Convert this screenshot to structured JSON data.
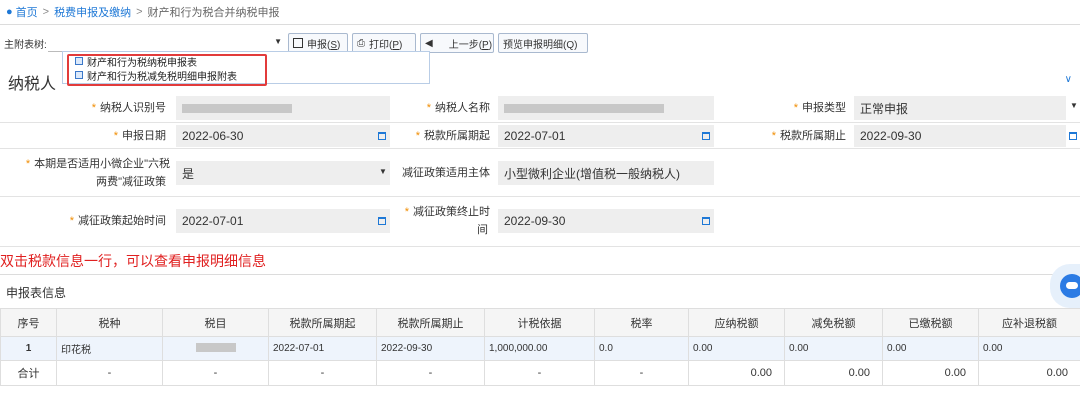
{
  "breadcrumb": {
    "home": "首页",
    "section": "税费申报及缴纳",
    "current": "财产和行为税合并纳税申报"
  },
  "toolbar": {
    "main_sub_label": "主附表树:",
    "declare_label": "申报(",
    "declare_key": "S",
    "print_label": "打印(",
    "print_key": "P",
    "prev_label": "上一步(",
    "prev_key": "P",
    "preview_label": "预览申报明细(Q)"
  },
  "dropdown": {
    "items": [
      "财产和行为税纳税申报表",
      "财产和行为税减免税明细申报附表"
    ]
  },
  "panel": {
    "title_visible": "纳税人"
  },
  "form": {
    "taxpayer_id_label": "纳税人识别号",
    "taxpayer_name_label": "纳税人名称",
    "declare_type_label": "申报类型",
    "declare_type_value": "正常申报",
    "declare_date_label": "申报日期",
    "declare_date_value": "2022-06-30",
    "period_start_label": "税款所属期起",
    "period_start_value": "2022-07-01",
    "period_end_label": "税款所属期止",
    "period_end_value": "2022-09-30",
    "six_tax_label_line1": "本期是否适用小微企业\"六税",
    "six_tax_label_line2": "两费\"减征政策",
    "six_tax_value": "是",
    "policy_subject_label": "减征政策适用主体",
    "policy_subject_value": "小型微利企业(增值税一般纳税人)",
    "policy_start_label": "减征政策起始时间",
    "policy_start_value": "2022-07-01",
    "policy_end_label_line1": "减征政策终止时",
    "policy_end_label_line2": "间",
    "policy_end_value": "2022-09-30"
  },
  "tip": "双击税款信息一行，可以查看申报明细信息",
  "section_title": "申报表信息",
  "table": {
    "headers": [
      "序号",
      "税种",
      "税目",
      "税款所属期起",
      "税款所属期止",
      "计税依据",
      "税率",
      "应纳税额",
      "减免税额",
      "已缴税额",
      "应补退税额"
    ],
    "row1": {
      "seq": "1",
      "tax_type": "印花税",
      "period_start": "2022-07-01",
      "period_end": "2022-09-30",
      "basis": "1,000,000.00",
      "rate": "0.0",
      "payable": "0.00",
      "reduced": "0.00",
      "paid": "0.00",
      "refund": "0.00"
    },
    "sum": {
      "label": "合计",
      "dash": "-",
      "payable": "0.00",
      "reduced": "0.00",
      "paid": "0.00",
      "refund": "0.00"
    }
  },
  "colors": {
    "link": "#1e78d6",
    "required": "#f08c00",
    "tip": "#e02020",
    "highlight_box": "#e23b3b"
  }
}
